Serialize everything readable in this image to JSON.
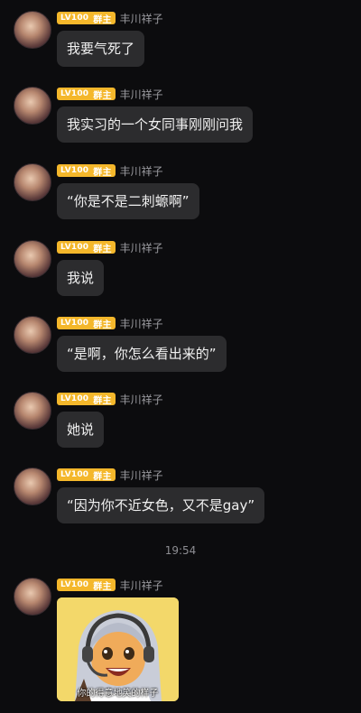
{
  "sender": {
    "name": "丰川祥子",
    "level": "LV100",
    "role": "群主",
    "badge_color": "#f4b72b",
    "avatar_icon": "anime-avatar-icon"
  },
  "messages": [
    {
      "text": "我要气死了"
    },
    {
      "text": "我实习的一个女同事刚刚问我"
    },
    {
      "text": "“你是不是二刺螈啊”"
    },
    {
      "text": "我说"
    },
    {
      "text": "“是啊，你怎么看出来的”"
    },
    {
      "text": "她说"
    },
    {
      "text": "“因为你不近女色，又不是gay”"
    }
  ],
  "timestamp": "19:54",
  "sticker": {
    "caption": "你的得意地笑的样子",
    "icon": "anime-girl-headset-sticker"
  },
  "colors": {
    "background": "#0c0c0e",
    "bubble": "#2c2c2e",
    "text": "#f0f0f0",
    "sender_name": "#9b9ba0"
  }
}
